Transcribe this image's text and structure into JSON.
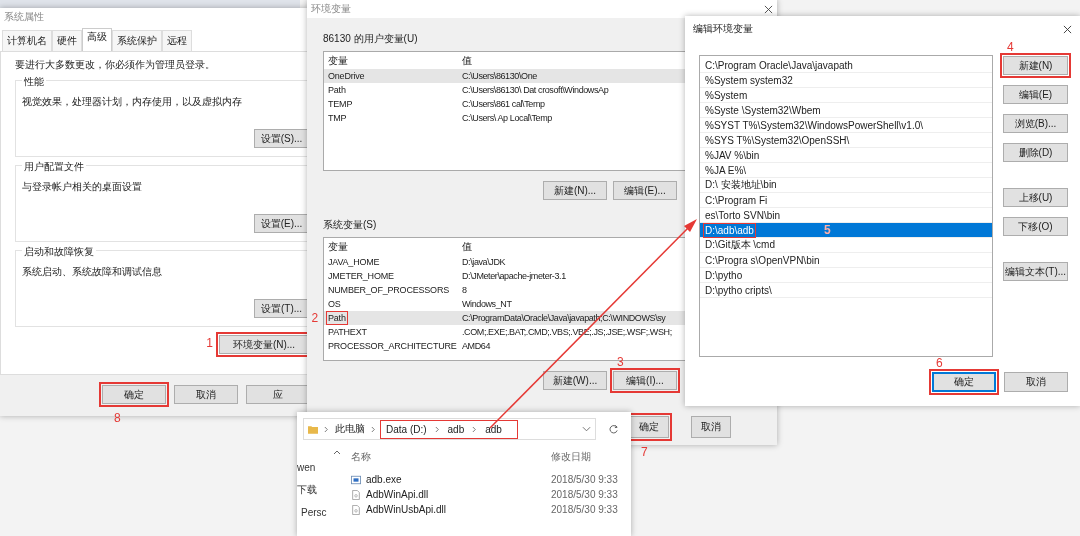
{
  "system_properties": {
    "title": "系统属性",
    "tabs": [
      {
        "label": "计算机名",
        "selected": false
      },
      {
        "label": "硬件",
        "selected": false
      },
      {
        "label": "高级",
        "selected": true
      },
      {
        "label": "系统保护",
        "selected": false
      },
      {
        "label": "远程",
        "selected": false
      }
    ],
    "notice": "要进行大多数更改，你必须作为管理员登录。",
    "groups": [
      {
        "title": "性能",
        "description": "视觉效果，处理器计划，内存使用，以及虚拟内存",
        "button": "设置(S)..."
      },
      {
        "title": "用户配置文件",
        "description": "与登录帐户相关的桌面设置",
        "button": "设置(E)..."
      },
      {
        "title": "启动和故障恢复",
        "description": "系统启动、系统故障和调试信息",
        "button": "设置(T)..."
      }
    ],
    "env_button": {
      "label": "环境变量(N)...",
      "step": "1"
    },
    "buttons": [
      {
        "label": "确定",
        "step": "8"
      },
      {
        "label": "取消"
      },
      {
        "label": "应"
      }
    ]
  },
  "environment_variables": {
    "title": "环境变量",
    "user_section": {
      "title": "86130 的用户变量(U)",
      "columns": [
        "变量",
        "值"
      ],
      "rows": [
        {
          "name": "OneDrive",
          "value": "C:\\Users\\86130\\One",
          "selected": true
        },
        {
          "name": "Path",
          "value": "C:\\Users\\86130\\ Dat crosoft\\WindowsAp",
          "selected": false
        },
        {
          "name": "TEMP",
          "value": "C:\\Users\\861 cal\\Temp",
          "selected": false
        },
        {
          "name": "TMP",
          "value": "C:\\Users\\ Ap Local\\Temp",
          "selected": false
        }
      ],
      "buttons": [
        {
          "label": "新建(N)..."
        },
        {
          "label": "编辑(E)..."
        }
      ]
    },
    "system_section": {
      "title": "系统变量(S)",
      "columns": [
        "变量",
        "值"
      ],
      "rows": [
        {
          "name": "JAVA_HOME",
          "value": "D:\\java\\JDK",
          "selected": false
        },
        {
          "name": "JMETER_HOME",
          "value": "D:\\JMeter\\apache-jmeter-3.1",
          "selected": false
        },
        {
          "name": "NUMBER_OF_PROCESSORS",
          "value": "8",
          "selected": false
        },
        {
          "name": "OS",
          "value": "Windows_NT",
          "selected": false
        },
        {
          "name": "Path",
          "value": "C:\\ProgramData\\Oracle\\Java\\javapath;C:\\WINDOWS\\sy",
          "selected": true,
          "step": "2"
        },
        {
          "name": "PATHEXT",
          "value": ".COM;.EXE;.BAT;.CMD;.VBS;.VBE;.JS;.JSE;.WSF;.WSH;",
          "selected": false
        },
        {
          "name": "PROCESSOR_ARCHITECTURE",
          "value": "AMD64",
          "selected": false
        }
      ],
      "buttons": [
        {
          "label": "新建(W)..."
        },
        {
          "label": "编辑(I)...",
          "step": "3"
        }
      ]
    },
    "buttons": [
      {
        "label": "确定",
        "step": "7"
      },
      {
        "label": "取消"
      }
    ]
  },
  "edit_dialog": {
    "title": "编辑环境变量",
    "items": [
      {
        "text": "C:\\Program  Oracle\\Java\\javapath",
        "selected": false
      },
      {
        "text": "%System  system32",
        "selected": false
      },
      {
        "text": "%System",
        "selected": false
      },
      {
        "text": "%Syste  \\System32\\Wbem",
        "selected": false
      },
      {
        "text": "%SYST  T%\\System32\\WindowsPowerShell\\v1.0\\",
        "selected": false
      },
      {
        "text": "%SYS  T%\\System32\\OpenSSH\\",
        "selected": false
      },
      {
        "text": "%JAV  %\\bin",
        "selected": false
      },
      {
        "text": "%JA  E%\\",
        "selected": false
      },
      {
        "text": "D:\\  安装地址\\bin",
        "selected": false
      },
      {
        "text": "C:\\Program Fi",
        "selected": false
      },
      {
        "text": "es\\Torto  SVN\\bin",
        "selected": false
      },
      {
        "text": "D:\\adb\\adb",
        "selected": true,
        "step": "5"
      },
      {
        "text": "D:\\Git版本  \\cmd",
        "selected": false
      },
      {
        "text": "C:\\Progra  s\\OpenVPN\\bin",
        "selected": false
      },
      {
        "text": "D:\\pytho",
        "selected": false
      },
      {
        "text": "D:\\pytho  cripts\\",
        "selected": false
      }
    ],
    "side_buttons": [
      {
        "label": "新建(N)",
        "step": "4"
      },
      {
        "label": "编辑(E)"
      },
      {
        "label": "浏览(B)..."
      },
      {
        "label": "删除(D)"
      },
      {
        "label": "上移(U)"
      },
      {
        "label": "下移(O)"
      },
      {
        "label": "编辑文本(T)..."
      }
    ],
    "buttons": [
      {
        "label": "确定",
        "focused": true,
        "step": "6"
      },
      {
        "label": "取消",
        "focused": false
      }
    ]
  },
  "explorer": {
    "location": "此电脑",
    "path": [
      "Data (D:)",
      "adb",
      "adb"
    ],
    "path_highlighted": true,
    "nav": [
      "wen",
      "下载",
      "Persc"
    ],
    "columns": [
      "名称",
      "修改日期"
    ],
    "files": [
      {
        "name": "adb.exe",
        "date": "2018/5/30 9:33",
        "kind": "exe"
      },
      {
        "name": "AdbWinApi.dll",
        "date": "2018/5/30 9:33",
        "kind": "dll"
      },
      {
        "name": "AdbWinUsbApi.dll",
        "date": "2018/5/30 9:33",
        "kind": "dll"
      }
    ]
  }
}
